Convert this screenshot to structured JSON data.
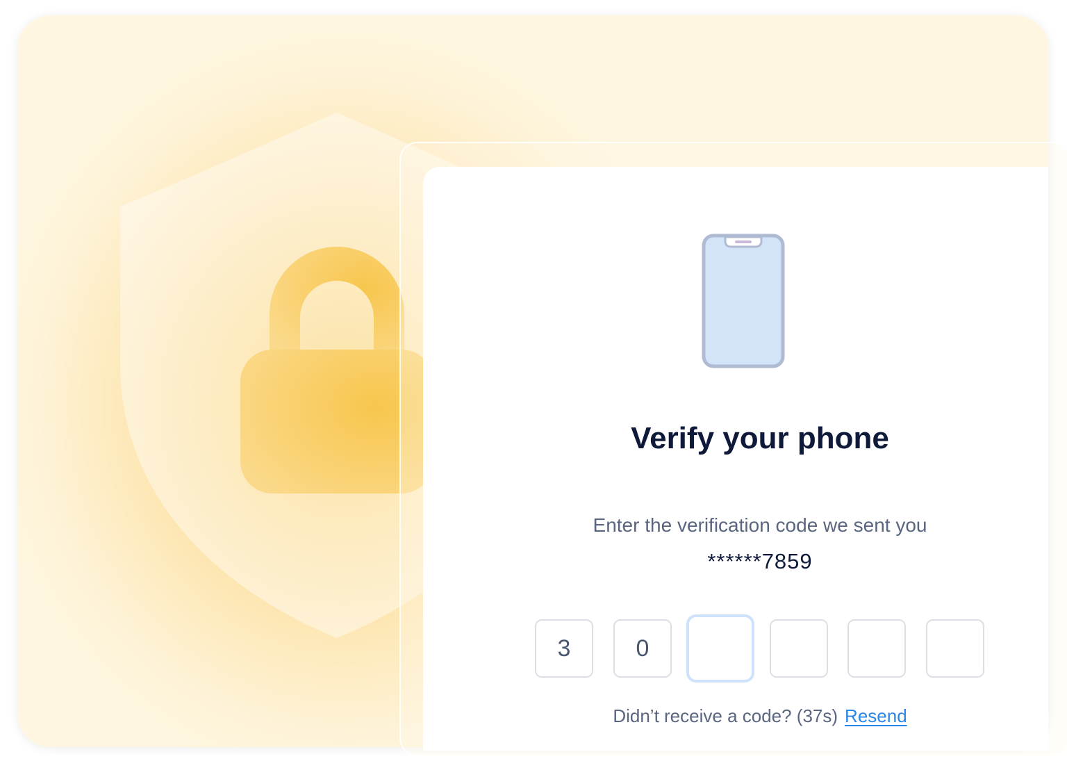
{
  "verification": {
    "title": "Verify your phone",
    "subtitle": "Enter the verification code we sent you",
    "masked_phone": "******7859",
    "code_digits": [
      "3",
      "0",
      "",
      "",
      "",
      ""
    ],
    "resend_prompt": "Didn’t receive a code? (37s)",
    "resend_label": "Resend"
  },
  "icons": {
    "background_shield": "shield-icon",
    "background_lock": "lock-icon",
    "phone": "smartphone-icon"
  },
  "colors": {
    "title": "#0f1a3a",
    "body_text": "#5a6580",
    "link": "#2a86e8",
    "accent_gold": "#f8cd63",
    "active_box_border": "#cfe2fb",
    "phone_screen": "#d4e4f8"
  }
}
